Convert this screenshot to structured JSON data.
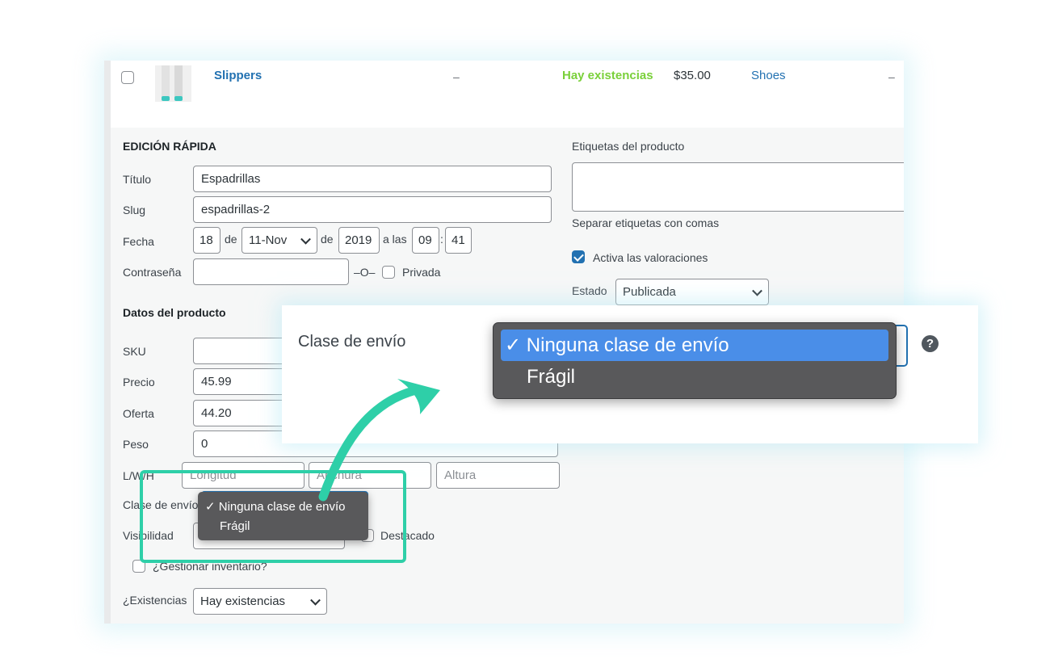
{
  "product_row": {
    "name": "Slippers",
    "sku": "–",
    "stock": "Hay existencias",
    "price": "$35.00",
    "category": "Shoes",
    "tags": "–"
  },
  "quick_edit": {
    "heading": "EDICIÓN RÁPIDA",
    "titulo_label": "Título",
    "titulo_value": "Espadrillas",
    "slug_label": "Slug",
    "slug_value": "espadrillas-2",
    "fecha_label": "Fecha",
    "day": "18",
    "de1": "de",
    "month": "11-Nov",
    "de2": "de",
    "year": "2019",
    "a_las": "a las",
    "hour": "09",
    "colon": ":",
    "minute": "41",
    "contrasena_label": "Contraseña",
    "o_sep": "–O–",
    "privada_label": "Privada"
  },
  "product_data": {
    "heading": "Datos del producto",
    "sku_label": "SKU",
    "precio_label": "Precio",
    "precio_value": "45.99",
    "oferta_label": "Oferta",
    "oferta_value": "44.20",
    "peso_label": "Peso",
    "peso_value": "0",
    "dims_label": "L/W/H",
    "longitud_ph": "Longitud",
    "anchura_ph": "Anchura",
    "altura_ph": "Altura",
    "clase_label": "Clase de envío",
    "visibilidad_label": "Visibilidad",
    "destacado_label": "Destacado",
    "gestionar_label": "¿Gestionar inventario?",
    "existencias_label": "¿Existencias",
    "existencias_value": "Hay existencias"
  },
  "right_col": {
    "etiquetas_label": "Etiquetas del producto",
    "etiquetas_help": "Separar etiquetas con comas",
    "valoraciones_label": "Activa las valoraciones",
    "estado_label": "Estado",
    "estado_value": "Publicada"
  },
  "shipping_menu": {
    "options": [
      "Ninguna clase de envío",
      "Frágil"
    ],
    "selected": "Ninguna clase de envío",
    "check": "✓"
  },
  "zoom_card": {
    "label": "Clase de envío",
    "help": "?"
  },
  "colors": {
    "accent": "#2271b1",
    "stock_green": "#7ad03a",
    "highlight_teal": "#2ecfa8",
    "menu_bg": "#59595b",
    "menu_selected": "#4a8ee8"
  }
}
